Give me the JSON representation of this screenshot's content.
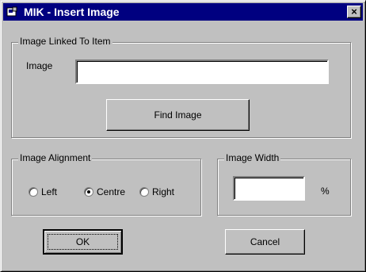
{
  "window": {
    "title": "MIK - Insert Image",
    "close_label": "×"
  },
  "linked_group": {
    "legend": "Image Linked To Item",
    "image_label": "Image",
    "image_value": "",
    "find_button": "Find Image"
  },
  "alignment_group": {
    "legend": "Image Alignment",
    "options": [
      {
        "label": "Left",
        "selected": false
      },
      {
        "label": "Centre",
        "selected": true
      },
      {
        "label": "Right",
        "selected": false
      }
    ]
  },
  "width_group": {
    "legend": "Image Width",
    "value": "",
    "unit": "%"
  },
  "buttons": {
    "ok": "OK",
    "cancel": "Cancel"
  }
}
